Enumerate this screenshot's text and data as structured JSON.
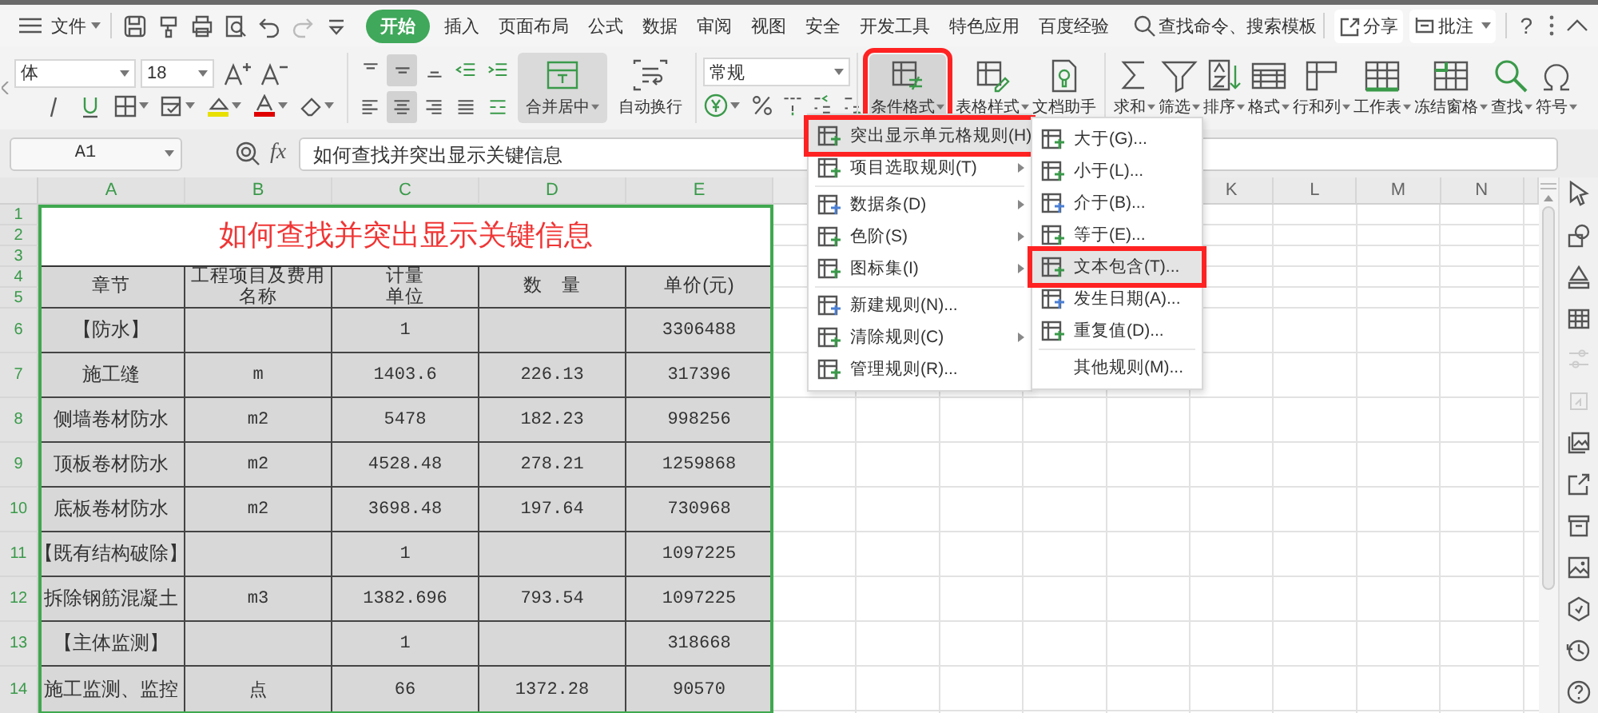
{
  "menu_bar": {
    "file": "文件",
    "tabs": [
      {
        "label": "开始",
        "selected": true
      },
      {
        "label": "插入",
        "selected": false
      },
      {
        "label": "页面布局",
        "selected": false
      },
      {
        "label": "公式",
        "selected": false
      },
      {
        "label": "数据",
        "selected": false
      },
      {
        "label": "审阅",
        "selected": false
      },
      {
        "label": "视图",
        "selected": false
      },
      {
        "label": "安全",
        "selected": false
      },
      {
        "label": "开发工具",
        "selected": false
      },
      {
        "label": "特色应用",
        "selected": false
      },
      {
        "label": "百度经验",
        "selected": false
      }
    ],
    "search": "查找命令、搜索模板",
    "share": "分享",
    "comment": "批注",
    "help": "?"
  },
  "ribbon": {
    "font_name": "体",
    "font_size": "18",
    "alignment": [
      {
        "selected": false
      },
      {
        "selected": true
      },
      {
        "selected": false
      },
      {
        "selected": false
      },
      {
        "selected": false
      },
      {
        "selected": false
      },
      {
        "selected": true
      },
      {
        "selected": false
      },
      {
        "selected": false
      },
      {
        "selected": false
      }
    ],
    "merge": {
      "label": "合并居中",
      "selected": true
    },
    "wrap": {
      "label": "自动换行",
      "selected": false
    },
    "number_format": "常规",
    "tools": [
      {
        "label": "条件格式",
        "dropdown": true,
        "selected": true,
        "highlighted": true
      },
      {
        "label": "表格样式",
        "dropdown": true,
        "selected": false,
        "highlighted": false
      },
      {
        "label": "文档助手",
        "dropdown": false,
        "selected": false,
        "highlighted": false
      },
      {
        "label": "求和",
        "dropdown": true,
        "selected": false,
        "highlighted": false
      },
      {
        "label": "筛选",
        "dropdown": true,
        "selected": false,
        "highlighted": false
      },
      {
        "label": "排序",
        "dropdown": true,
        "selected": false,
        "highlighted": false
      },
      {
        "label": "格式",
        "dropdown": true,
        "selected": false,
        "highlighted": false
      },
      {
        "label": "行和列",
        "dropdown": true,
        "selected": false,
        "highlighted": false
      },
      {
        "label": "工作表",
        "dropdown": true,
        "selected": false,
        "highlighted": false
      },
      {
        "label": "冻结窗格",
        "dropdown": true,
        "selected": false,
        "highlighted": false
      },
      {
        "label": "查找",
        "dropdown": true,
        "selected": false,
        "highlighted": false
      },
      {
        "label": "符号",
        "dropdown": true,
        "selected": false,
        "highlighted": false
      }
    ]
  },
  "formula_bar": {
    "name_box": "A1",
    "fx": "fx",
    "formula": "如何查找并突出显示关键信息"
  },
  "sheet": {
    "columns": [
      {
        "label": "A",
        "selected": true
      },
      {
        "label": "B",
        "selected": true
      },
      {
        "label": "C",
        "selected": true
      },
      {
        "label": "D",
        "selected": true
      },
      {
        "label": "E",
        "selected": true
      },
      {
        "label": "K",
        "selected": false
      },
      {
        "label": "L",
        "selected": false
      },
      {
        "label": "M",
        "selected": false
      },
      {
        "label": "N",
        "selected": false
      }
    ],
    "row_numbers": [
      {
        "label": "1",
        "selected": true
      },
      {
        "label": "2",
        "selected": true
      },
      {
        "label": "3",
        "selected": true
      },
      {
        "label": "4",
        "selected": true
      },
      {
        "label": "5",
        "selected": true
      },
      {
        "label": "6",
        "selected": true
      },
      {
        "label": "7",
        "selected": true
      },
      {
        "label": "8",
        "selected": true
      },
      {
        "label": "9",
        "selected": true
      },
      {
        "label": "10",
        "selected": true
      },
      {
        "label": "11",
        "selected": true
      },
      {
        "label": "12",
        "selected": true
      },
      {
        "label": "13",
        "selected": true
      },
      {
        "label": "14",
        "selected": true
      }
    ],
    "title": "如何查找并突出显示关键信息",
    "header": [
      "章节",
      "工程项目及费用名称",
      "计量单位",
      "数　量",
      "单价(元)"
    ],
    "rows": [
      [
        "【防水】",
        "",
        "1",
        "",
        "3306488"
      ],
      [
        "施工缝",
        "m",
        "1403.6",
        "226.13",
        "317396"
      ],
      [
        "侧墙卷材防水",
        "m2",
        "5478",
        "182.23",
        "998256"
      ],
      [
        "顶板卷材防水",
        "m2",
        "4528.48",
        "278.21",
        "1259868"
      ],
      [
        "底板卷材防水",
        "m2",
        "3698.48",
        "197.64",
        "730968"
      ],
      [
        "【既有结构破除】",
        "",
        "1",
        "",
        "1097225"
      ],
      [
        "拆除钢筋混凝土",
        "m3",
        "1382.696",
        "793.54",
        "1097225"
      ],
      [
        "【主体监测】",
        "",
        "1",
        "",
        "318668"
      ],
      [
        "施工监测、监控",
        "点",
        "66",
        "1372.28",
        "90570"
      ]
    ]
  },
  "conditional_menu": {
    "items": [
      {
        "kind": "item",
        "label": "突出显示单元格规则(H)",
        "submenu": true,
        "selected": true,
        "highlighted": true
      },
      {
        "kind": "item",
        "label": "项目选取规则(T)",
        "submenu": true,
        "selected": false,
        "highlighted": false
      },
      {
        "kind": "divider"
      },
      {
        "kind": "item",
        "label": "数据条(D)",
        "submenu": true,
        "selected": false,
        "highlighted": false
      },
      {
        "kind": "item",
        "label": "色阶(S)",
        "submenu": true,
        "selected": false,
        "highlighted": false
      },
      {
        "kind": "item",
        "label": "图标集(I)",
        "submenu": true,
        "selected": false,
        "highlighted": false
      },
      {
        "kind": "divider"
      },
      {
        "kind": "item",
        "label": "新建规则(N)...",
        "submenu": false,
        "selected": false,
        "highlighted": false
      },
      {
        "kind": "item",
        "label": "清除规则(C)",
        "submenu": true,
        "selected": false,
        "highlighted": false
      },
      {
        "kind": "item",
        "label": "管理规则(R)...",
        "submenu": false,
        "selected": false,
        "highlighted": false
      }
    ]
  },
  "highlight_submenu": {
    "items": [
      {
        "kind": "item",
        "label": "大于(G)...",
        "selected": false,
        "highlighted": false
      },
      {
        "kind": "item",
        "label": "小于(L)...",
        "selected": false,
        "highlighted": false
      },
      {
        "kind": "item",
        "label": "介于(B)...",
        "selected": false,
        "highlighted": false
      },
      {
        "kind": "item",
        "label": "等于(E)...",
        "selected": false,
        "highlighted": false
      },
      {
        "kind": "item",
        "label": "文本包含(T)...",
        "selected": true,
        "highlighted": true
      },
      {
        "kind": "item",
        "label": "发生日期(A)...",
        "selected": false,
        "highlighted": false
      },
      {
        "kind": "item",
        "label": "重复值(D)...",
        "selected": false,
        "highlighted": false
      },
      {
        "kind": "divider"
      },
      {
        "kind": "plain",
        "label": "其他规则(M)...",
        "selected": false,
        "highlighted": false
      }
    ]
  }
}
